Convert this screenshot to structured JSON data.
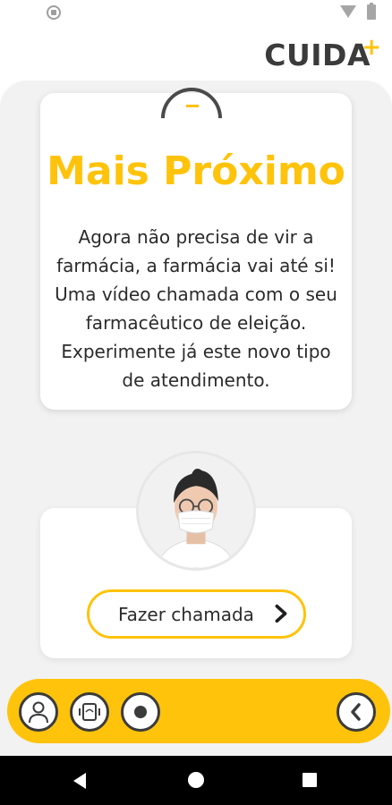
{
  "app": {
    "logo_text": "CUIDA",
    "logo_accent": "+"
  },
  "feature": {
    "title": "Mais Próximo",
    "description": "Agora não precisa de vir a farmácia, a farmácia vai até si! Uma vídeo chamada com o seu farmacêutico de eleição. Experimente já este novo tipo de atendimento."
  },
  "call": {
    "button_label": "Fazer chamada",
    "button_icon": "chevron-right-icon"
  },
  "bottom_nav": {
    "items": [
      {
        "icon": "user-icon"
      },
      {
        "icon": "video-call-icon"
      },
      {
        "icon": "record-icon"
      }
    ],
    "back_icon": "chevron-left-icon"
  },
  "colors": {
    "accent": "#ffc30b",
    "text_dark": "#2b2b2b",
    "background": "#f2f2f2"
  }
}
